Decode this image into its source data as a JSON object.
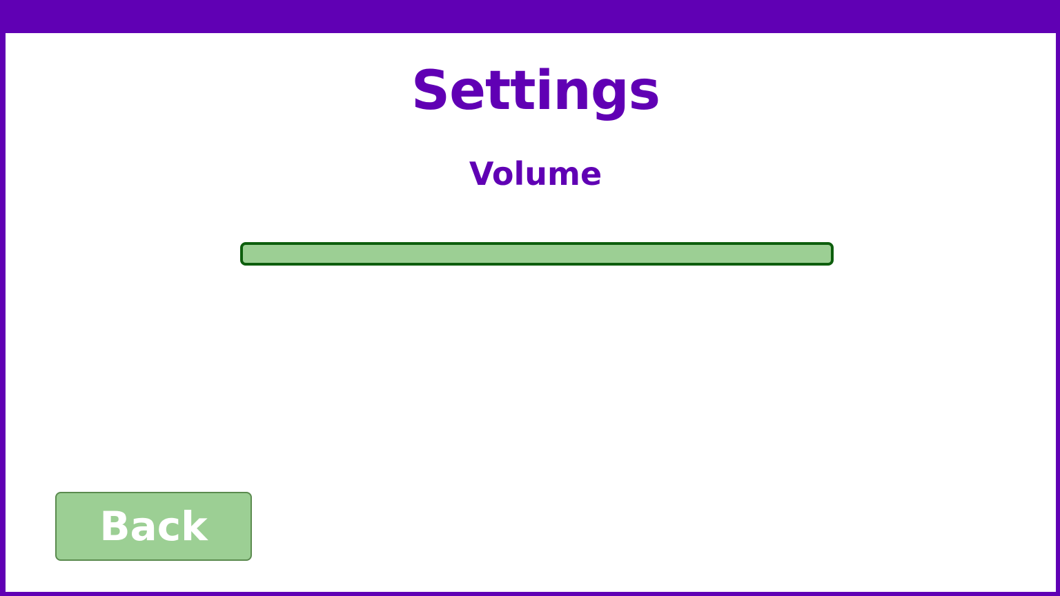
{
  "screen": {
    "title": "Settings",
    "section_label": "Volume",
    "volume_slider": {
      "level": 1.0,
      "fill_color": "#9ccf94",
      "border_color": "#0d5e0d"
    },
    "back_button_label": "Back"
  },
  "colors": {
    "accent": "#6000b4",
    "button_fill": "#9ccf94",
    "button_text": "#ffffff"
  }
}
